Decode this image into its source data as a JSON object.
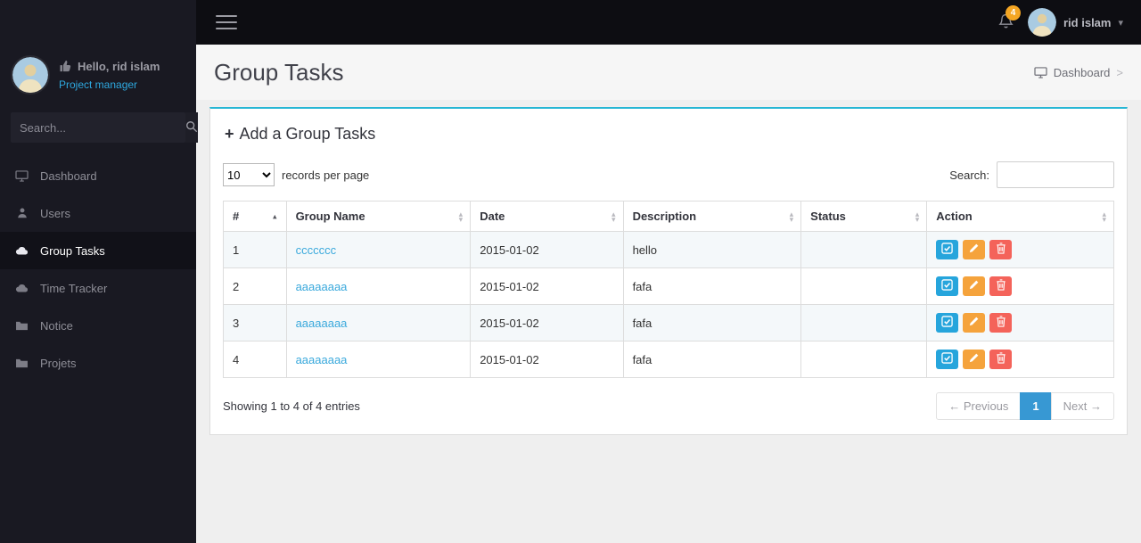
{
  "colors": {
    "panel_accent": "#27b6d4",
    "link": "#3aa9dc",
    "badge": "#f5a623",
    "role_text": "#2ea9e0",
    "pagination_active": "#3798d3",
    "action_check": "#26a5dc",
    "action_edit": "#f5a33c",
    "action_delete": "#f4635a",
    "sidebar_bg": "#191922",
    "topbar_bg": "#0d0d12"
  },
  "icons": {
    "plus": "+",
    "caret_down": "▾",
    "sort_asc": "▴",
    "sort_desc": "▾"
  },
  "topbar": {
    "notification_count": "4",
    "user_name": "rid islam"
  },
  "sidebar": {
    "greeting": "Hello, rid islam",
    "role": "Project manager",
    "search_placeholder": "Search...",
    "items": [
      {
        "label": "Dashboard",
        "icon": "desktop-icon",
        "active": false
      },
      {
        "label": "Users",
        "icon": "user-icon",
        "active": false
      },
      {
        "label": "Group Tasks",
        "icon": "cloud-icon",
        "active": true
      },
      {
        "label": "Time Tracker",
        "icon": "cloud-icon",
        "active": false
      },
      {
        "label": "Notice",
        "icon": "folder-icon",
        "active": false
      },
      {
        "label": "Projets",
        "icon": "folder-icon",
        "active": false
      }
    ]
  },
  "page": {
    "title": "Group Tasks",
    "breadcrumb_label": "Dashboard",
    "breadcrumb_sep": ">"
  },
  "panel": {
    "title": "Add a Group Tasks",
    "records_per_page_value": "10",
    "records_per_page_label": "records per page",
    "search_label": "Search:",
    "table": {
      "headers": [
        "#",
        "Group Name",
        "Date",
        "Description",
        "Status",
        "Action"
      ],
      "rows": [
        {
          "num": "1",
          "group_name": "ccccccc",
          "date": "2015-01-02",
          "description": "hello",
          "status": ""
        },
        {
          "num": "2",
          "group_name": "aaaaaaaa",
          "date": "2015-01-02",
          "description": "fafa",
          "status": ""
        },
        {
          "num": "3",
          "group_name": "aaaaaaaa",
          "date": "2015-01-02",
          "description": "fafa",
          "status": ""
        },
        {
          "num": "4",
          "group_name": "aaaaaaaa",
          "date": "2015-01-02",
          "description": "fafa",
          "status": ""
        }
      ]
    },
    "summary": "Showing 1 to 4 of 4 entries",
    "pagination": {
      "previous": "← Previous",
      "page": "1",
      "next": "Next →"
    }
  }
}
